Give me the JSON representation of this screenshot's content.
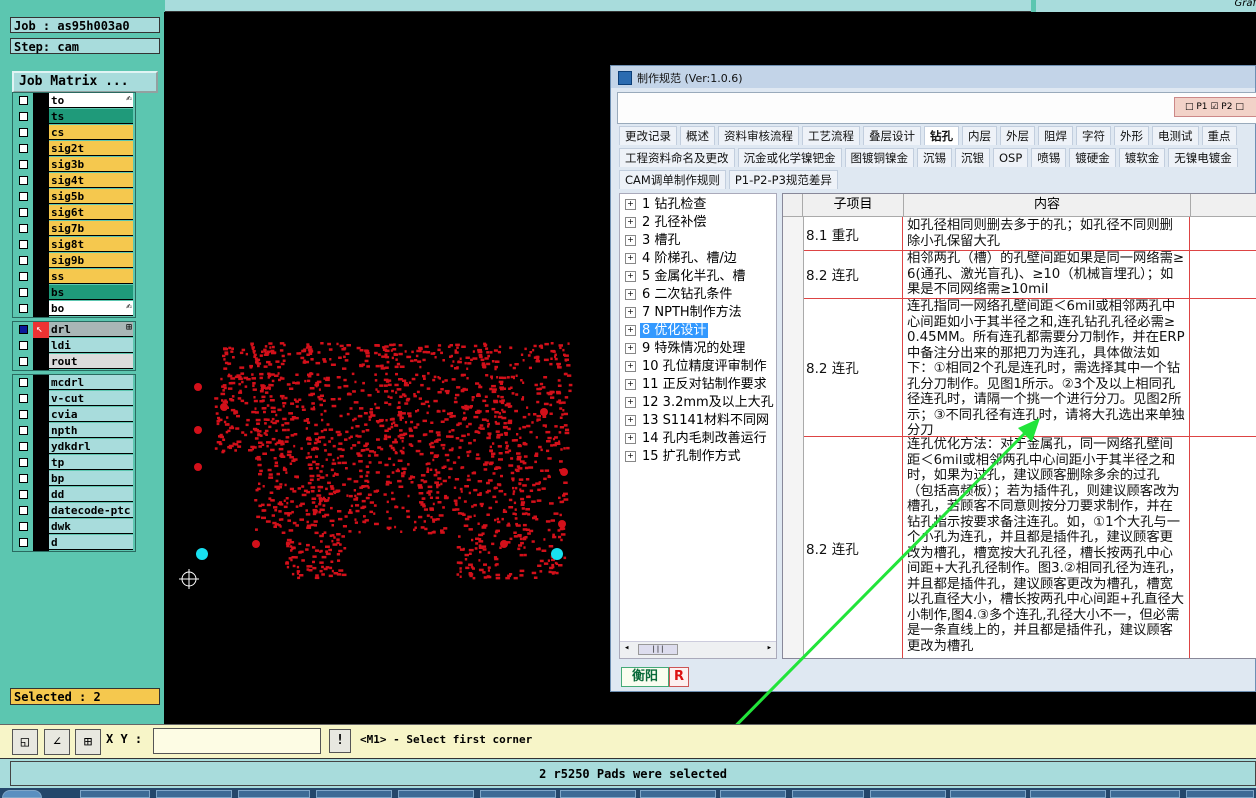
{
  "topbar": {
    "right_text": "Graf"
  },
  "job": {
    "label": "Job : as95h003a0",
    "step": "Step: cam",
    "matrix_button": "Job Matrix ..."
  },
  "layers": {
    "group1": [
      {
        "name": "to",
        "color": "#ffffff",
        "tail": "✍"
      },
      {
        "name": "ts",
        "color": "#1f9a7a",
        "tail": ""
      },
      {
        "name": "cs",
        "color": "#f5c84e",
        "tail": ""
      },
      {
        "name": "sig2t",
        "color": "#f5c84e",
        "tail": ""
      },
      {
        "name": "sig3b",
        "color": "#f5c84e",
        "tail": ""
      },
      {
        "name": "sig4t",
        "color": "#f5c84e",
        "tail": ""
      },
      {
        "name": "sig5b",
        "color": "#f5c84e",
        "tail": ""
      },
      {
        "name": "sig6t",
        "color": "#f5c84e",
        "tail": ""
      },
      {
        "name": "sig7b",
        "color": "#f5c84e",
        "tail": ""
      },
      {
        "name": "sig8t",
        "color": "#f5c84e",
        "tail": ""
      },
      {
        "name": "sig9b",
        "color": "#f5c84e",
        "tail": ""
      },
      {
        "name": "ss",
        "color": "#f5c84e",
        "tail": ""
      },
      {
        "name": "bs",
        "color": "#1f9a7a",
        "tail": ""
      },
      {
        "name": "bo",
        "color": "#ffffff",
        "tail": "✍"
      }
    ],
    "group2": [
      {
        "name": "drl",
        "color": "#a9b6b6",
        "tail": "⊞"
      },
      {
        "name": "ldi",
        "color": "#a8dcdc",
        "tail": ""
      },
      {
        "name": "rout",
        "color": "#dcdcdc",
        "tail": ""
      }
    ],
    "group3": [
      {
        "name": "mcdrl",
        "color": "#a8dcdc",
        "tail": ""
      },
      {
        "name": "v-cut",
        "color": "#a8dcdc",
        "tail": ""
      },
      {
        "name": "cvia",
        "color": "#a8dcdc",
        "tail": ""
      },
      {
        "name": "npth",
        "color": "#a8dcdc",
        "tail": ""
      },
      {
        "name": "ydkdrl",
        "color": "#a8dcdc",
        "tail": ""
      },
      {
        "name": "tp",
        "color": "#a8dcdc",
        "tail": ""
      },
      {
        "name": "bp",
        "color": "#a8dcdc",
        "tail": ""
      },
      {
        "name": "dd",
        "color": "#a8dcdc",
        "tail": ""
      },
      {
        "name": "datecode-ptc",
        "color": "#a8dcdc",
        "tail": ""
      },
      {
        "name": "dwk",
        "color": "#a8dcdc",
        "tail": ""
      },
      {
        "name": "d",
        "color": "#a8dcdc",
        "tail": ""
      }
    ]
  },
  "selected": "Selected : 2",
  "cmd": {
    "xy_label": "X Y :",
    "xy_value": "",
    "xy_button": "!",
    "prompt": "<M1> - Select first corner"
  },
  "status": "2 r5250 Pads were selected",
  "dialog": {
    "title": "制作规范 (Ver:1.0.6)",
    "pcheck": "□ P1 ☑ P2 □",
    "tabs_row1": [
      "更改记录",
      "概述",
      "资料审核流程",
      "工艺流程",
      "叠层设计",
      "钻孔",
      "内层",
      "外层",
      "阻焊",
      "字符",
      "外形",
      "电测试",
      "重点"
    ],
    "tabs_row2": [
      "工程资料命名及更改",
      "沉金或化学镍钯金",
      "图镀铜镍金",
      "沉锡",
      "沉银",
      "OSP",
      "喷锡",
      "镀硬金",
      "镀软金",
      "无镍电镀金"
    ],
    "tabs_row3": [
      "CAM调单制作规则",
      "P1-P2-P3规范差异"
    ],
    "tree": [
      "1 钻孔检查",
      "2 孔径补偿",
      "3 槽孔",
      "4 阶梯孔、槽/边",
      "5 金属化半孔、槽",
      "6 二次钻孔条件",
      "7 NPTH制作方法",
      "8 优化设计",
      "9 特殊情况的处理",
      "10 孔位精度评审制作",
      "11 正反对钻制作要求",
      "12 3.2mm及以上大孔",
      "13 S1141材料不同网",
      "14 孔内毛刺改善运行",
      "15 扩孔制作方式"
    ],
    "tree_scroll": "|||",
    "grid_headers": [
      "子项目",
      "内容"
    ],
    "rows": [
      {
        "sub": "8.1 重孔",
        "content": "如孔径相同则删去多于的孔；如孔径不同则删除小孔保留大孔"
      },
      {
        "sub": "8.2 连孔",
        "content": "相邻两孔（槽）的孔壁间距如果是同一网络需≥6(通孔、激光盲孔)、≥10（机械盲埋孔）；如果是不同网络需≥10mil"
      },
      {
        "sub": "8.2 连孔",
        "content": "连孔指同一网络孔壁间距＜6mil或相邻两孔中心间距如小于其半径之和,连孔钻孔孔径必需≥0.45MM。所有连孔都需要分刀制作，并在ERP中备注分出来的那把刀为连孔，具体做法如下：①相同2个孔是连孔时，需选择其中一个钻孔分刀制作。见图1所示。②3个及以上相同孔径连孔时，请隔一个挑一个进行分刀。见图2所示；③不同孔径有连孔时，请将大孔选出来单独分刀"
      },
      {
        "sub": "8.2 连孔",
        "content": "连孔优化方法：对于金属孔，同一网络孔壁间距＜6mil或相邻两孔中心间距小于其半径之和时，如果为过孔，建议顾客删除多余的过孔（包括高频板）；若为插件孔，则建议顾客改为槽孔，若顾客不同意则按分刀要求制作，并在钻孔指示按要求备注连孔。如，①1个大孔与一个小孔为连孔，并且都是插件孔，建议顾客更改为槽孔，槽宽按大孔孔径，槽长按两孔中心间距+大孔孔径制作。图3.②相同孔径为连孔，并且都是插件孔，建议顾客更改为槽孔，槽宽以孔直径大小，槽长按两孔中心间距+孔直径大小制作,图4.③多个连孔,孔径大小不一，但必需是一条直线上的，并且都是插件孔，建议顾客更改为槽孔"
      }
    ],
    "footer_left": "衡阳",
    "footer_right": "R"
  }
}
